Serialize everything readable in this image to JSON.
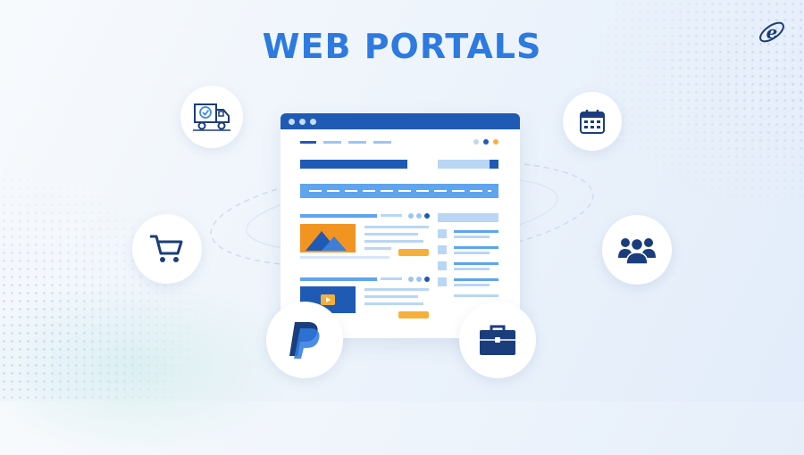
{
  "page": {
    "title": "WEB PORTALS",
    "brand_mark": "e"
  },
  "colors": {
    "title": "#2d7ae0",
    "navy": "#1b3d7c",
    "primary": "#1f5bb5",
    "light_blue": "#5ea4ef",
    "pale_blue": "#b9d6f5",
    "accent_orange": "#f5b03c",
    "image_orange": "#f29422"
  },
  "icons": [
    "delivery-truck-icon",
    "calendar-icon",
    "shopping-cart-icon",
    "users-group-icon",
    "paypal-icon",
    "briefcase-icon"
  ]
}
